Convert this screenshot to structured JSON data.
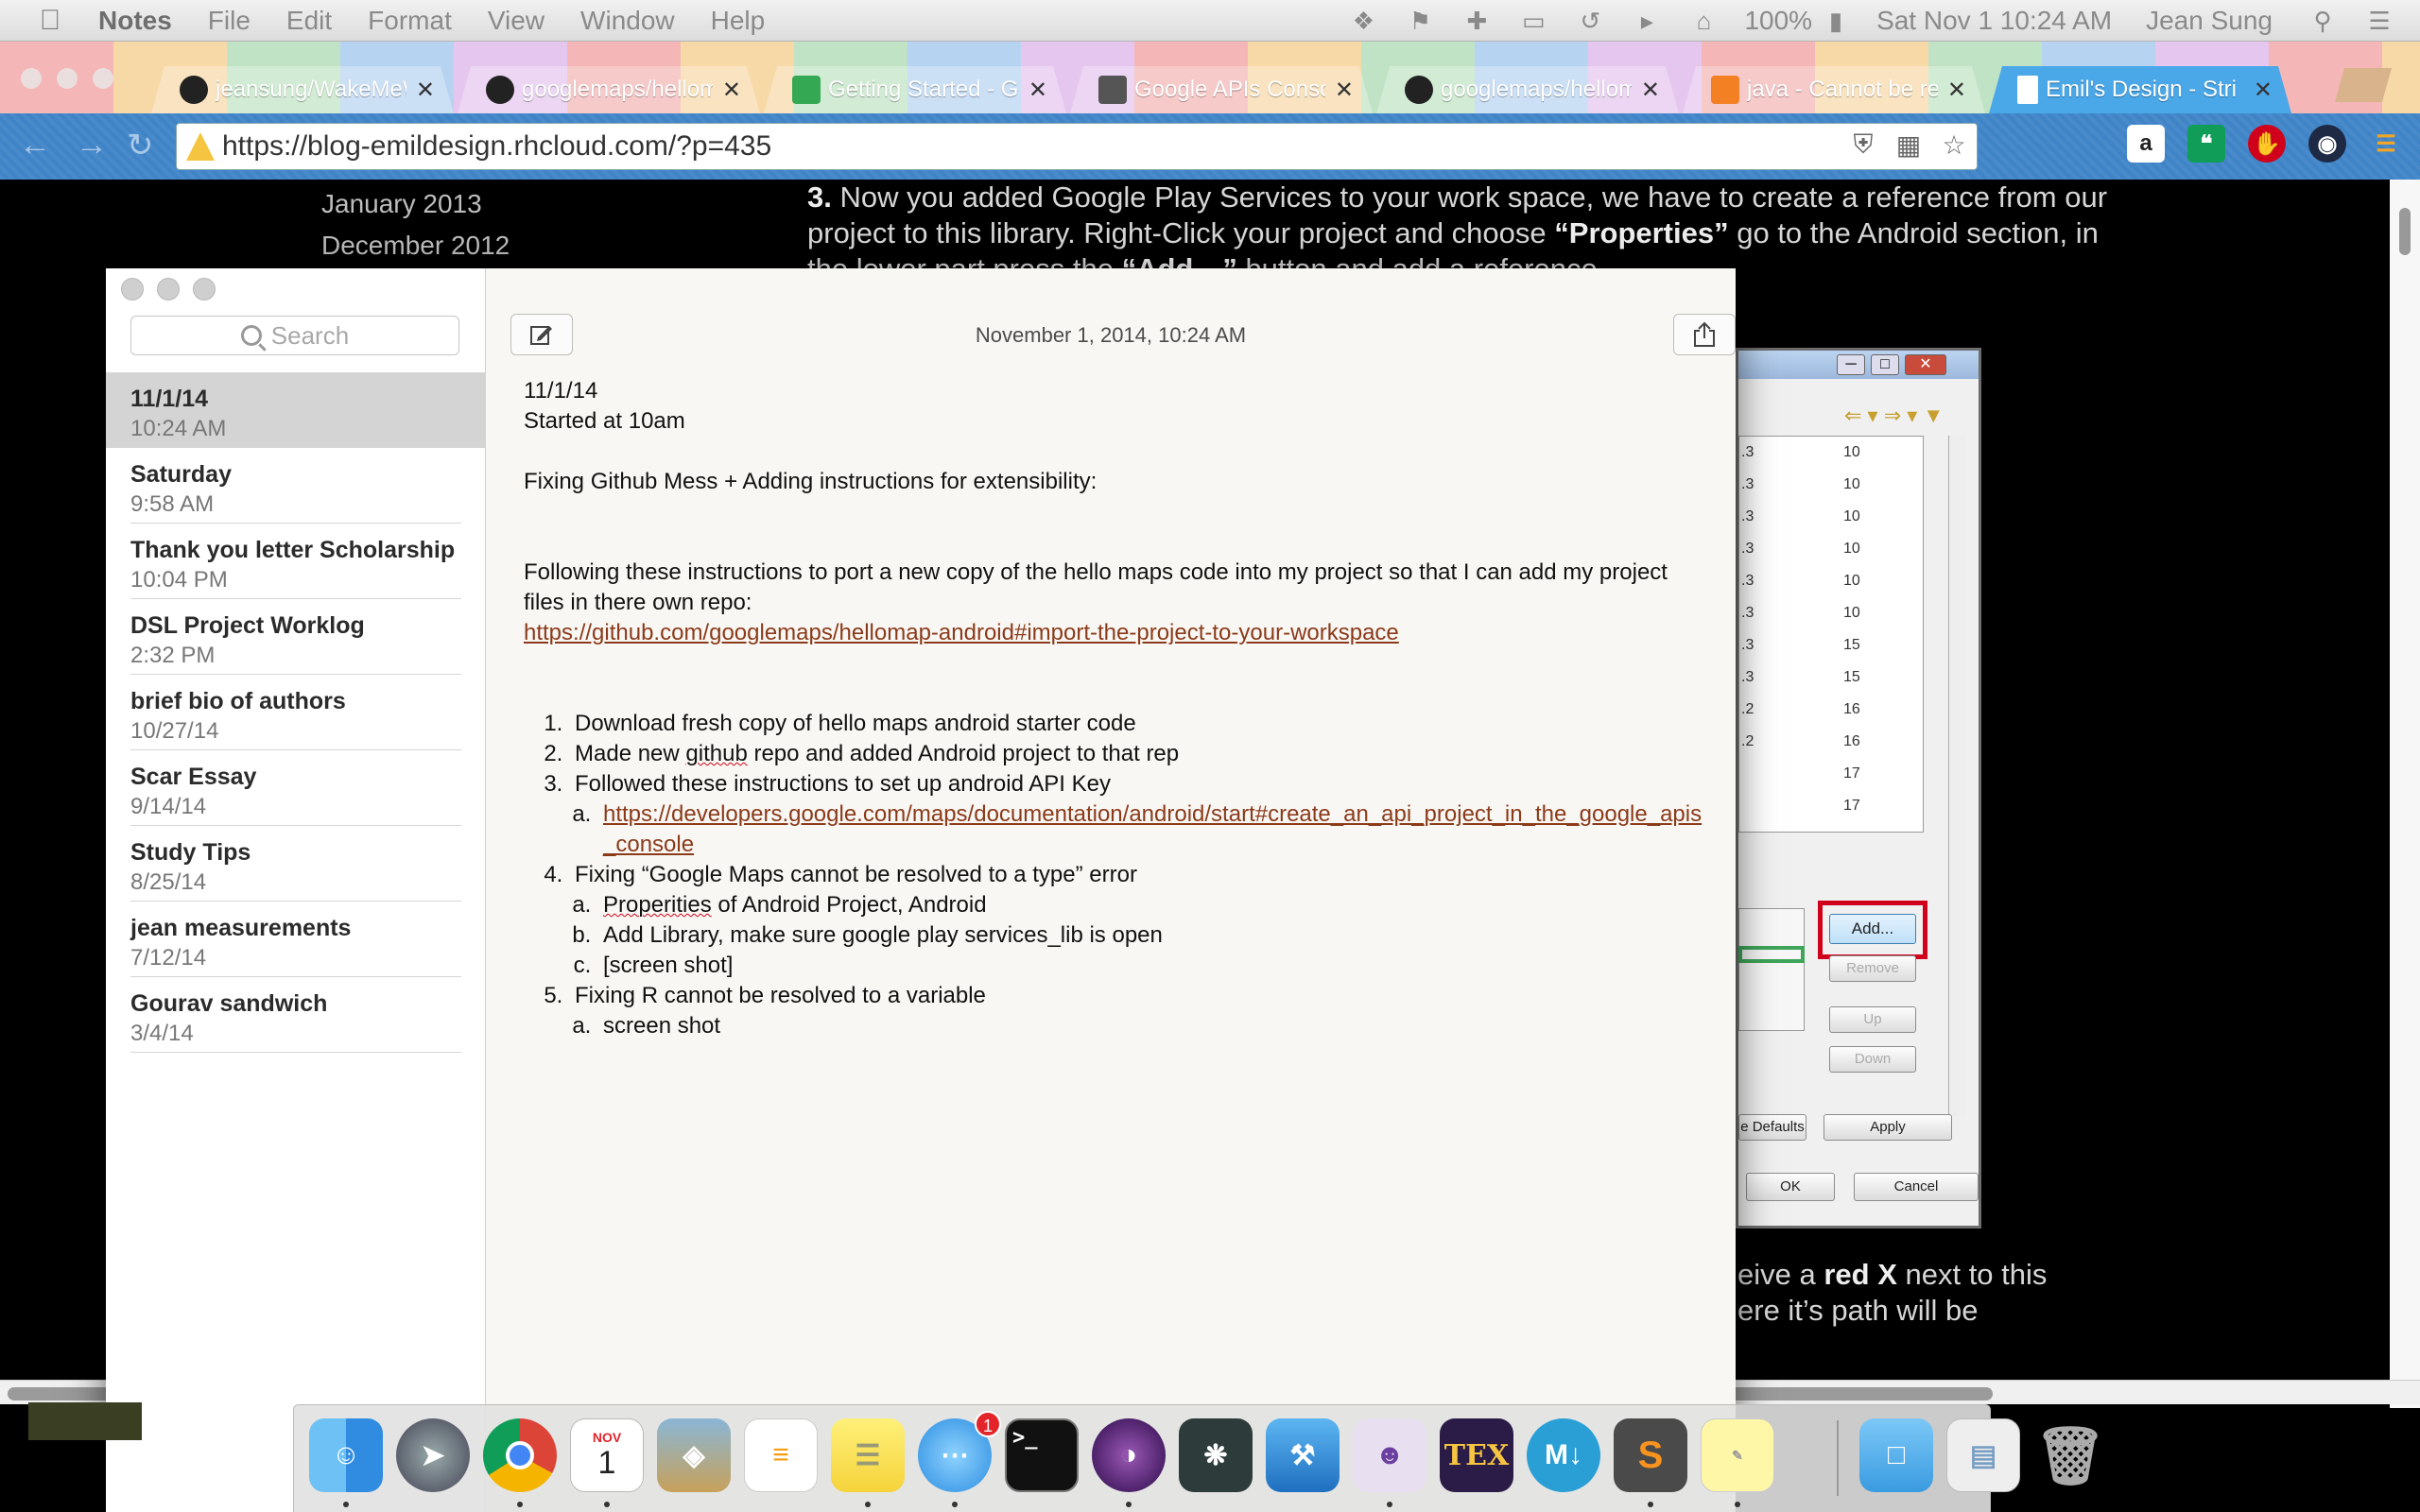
{
  "menubar": {
    "app": "Notes",
    "menus": [
      "File",
      "Edit",
      "Format",
      "View",
      "Window",
      "Help"
    ],
    "battery": "100%",
    "clock": "Sat Nov 1  10:24 AM",
    "user": "Jean Sung"
  },
  "tabs": [
    {
      "title": "jeansung/WakeMeW",
      "favicon": "github-icon"
    },
    {
      "title": "googlemaps/hellom",
      "favicon": "github-icon"
    },
    {
      "title": "Getting Started - Go",
      "favicon": "google-developers-icon"
    },
    {
      "title": "Google APIs Consol",
      "favicon": "google-apis-icon"
    },
    {
      "title": "googlemaps/hellom",
      "favicon": "github-icon"
    },
    {
      "title": "java - Cannot be res",
      "favicon": "stackoverflow-icon"
    },
    {
      "title": "Emil's Design - Stri",
      "favicon": "page-icon",
      "active": true
    }
  ],
  "address": "https://blog-emildesign.rhcloud.com/?p=435",
  "webpage": {
    "archive": [
      "January 2013",
      "December 2012"
    ],
    "step_number": "3.",
    "step_text_1": " Now you added Google Play Services to your work space, we have to create a reference from our project to this library. Right-Click your project and choose ",
    "step_bold_1": "“Properties”",
    "step_text_2": " go to the Android section, in the lower part press the ",
    "step_bold_2": "“Add…”",
    "step_text_3": " button and add a reference",
    "cont_1a": "eive a ",
    "cont_1b": "red X",
    "cont_1c": " next to this",
    "cont_2": "ere it’s path will be"
  },
  "dialog": {
    "rows": [
      [
        ".3",
        "10"
      ],
      [
        ".3",
        "10"
      ],
      [
        ".3",
        "10"
      ],
      [
        ".3",
        "10"
      ],
      [
        ".3",
        "10"
      ],
      [
        ".3",
        "10"
      ],
      [
        ".3",
        "15"
      ],
      [
        ".3",
        "15"
      ],
      [
        ".2",
        "16"
      ],
      [
        ".2",
        "16"
      ],
      [
        "",
        "17"
      ],
      [
        "",
        "17"
      ]
    ],
    "buttons": {
      "add": "Add...",
      "remove": "Remove",
      "up": "Up",
      "down": "Down",
      "defaults": "e Defaults",
      "apply": "Apply",
      "ok": "OK",
      "cancel": "Cancel"
    }
  },
  "notes": {
    "search_placeholder": "Search",
    "list": [
      {
        "title": "11/1/14",
        "date": "10:24 AM",
        "selected": true
      },
      {
        "title": "Saturday",
        "date": "9:58 AM"
      },
      {
        "title": "Thank you letter Scholarship",
        "date": "10:04 PM"
      },
      {
        "title": "DSL Project Worklog",
        "date": "2:32 PM"
      },
      {
        "title": "brief bio of authors",
        "date": "10/27/14"
      },
      {
        "title": "Scar Essay",
        "date": "9/14/14"
      },
      {
        "title": "Study Tips",
        "date": "8/25/14"
      },
      {
        "title": "jean measurements",
        "date": "7/12/14"
      },
      {
        "title": "Gourav sandwich",
        "date": "3/4/14"
      }
    ],
    "editor": {
      "date": "November 1, 2014, 10:24 AM",
      "line1": "11/1/14",
      "line2": "Started at 10am",
      "line3": "Fixing Github Mess + Adding instructions for extensibility:",
      "line4": "Following these instructions to port a new copy of the hello maps code into my project so that I can add my project files in there own repo:",
      "link1": "https://github.com/googlemaps/hellomap-android#import-the-project-to-your-workspace",
      "steps": {
        "s1": "Download fresh copy of hello maps android starter code",
        "s2a": "Made new ",
        "s2b": "github",
        "s2c": " repo and added Android project to that rep",
        "s3": "Followed these instructions to set up android API Key",
        "s3a": "https://developers.google.com/maps/documentation/android/start#create_an_api_project_in_the_google_apis_console",
        "s4": "Fixing “Google Maps cannot be resolved to a type” error",
        "s4a1": "Properities",
        "s4a2": " of Android Project, Android",
        "s4b": "Add Library, make sure google play services_lib is open",
        "s4c": "[screen shot]",
        "s5": "Fixing R cannot be resolved to a variable",
        "s5a": "screen shot"
      }
    }
  },
  "dock": {
    "calendar_month": "NOV",
    "calendar_day": "1",
    "messages_badge": "1",
    "terminal": ">_",
    "markdown": "M↓",
    "tex": "TEX",
    "sublime": "S"
  },
  "colors": {
    "link": "#8b3a1a",
    "highlight_box": "#d0021b",
    "active_tab": "#4aa7e8",
    "toolbar": "#3f84c7"
  }
}
